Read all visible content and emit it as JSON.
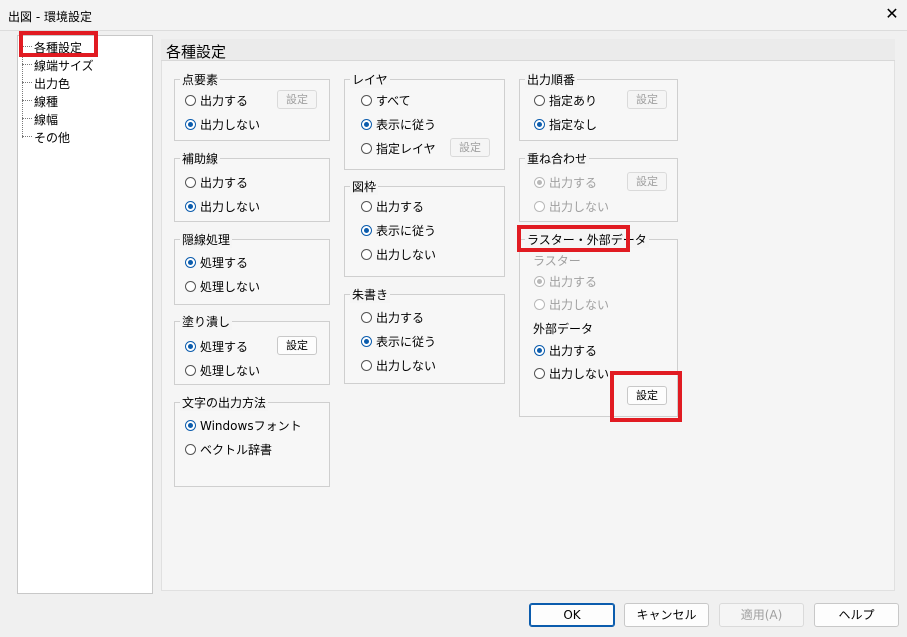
{
  "window": {
    "title": "出図 - 環境設定",
    "close_glyph": "✕"
  },
  "tree": {
    "items": [
      "各種設定",
      "線端サイズ",
      "出力色",
      "線種",
      "線幅",
      "その他"
    ]
  },
  "panel": {
    "title": "各種設定"
  },
  "groups": {
    "point": {
      "label": "点要素",
      "opt1": "出力する",
      "opt2": "出力しない",
      "button": "設定"
    },
    "aux": {
      "label": "補助線",
      "opt1": "出力する",
      "opt2": "出力しない"
    },
    "hidden": {
      "label": "隠線処理",
      "opt1": "処理する",
      "opt2": "処理しない"
    },
    "fill": {
      "label": "塗り潰し",
      "opt1": "処理する",
      "opt2": "処理しない",
      "button": "設定"
    },
    "text": {
      "label": "文字の出力方法",
      "opt1": "Windowsフォント",
      "opt2": "ベクトル辞書"
    },
    "layer": {
      "label": "レイヤ",
      "opt1": "すべて",
      "opt2": "表示に従う",
      "opt3": "指定レイヤ",
      "button": "設定"
    },
    "frame": {
      "label": "図枠",
      "opt1": "出力する",
      "opt2": "表示に従う",
      "opt3": "出力しない"
    },
    "redline": {
      "label": "朱書き",
      "opt1": "出力する",
      "opt2": "表示に従う",
      "opt3": "出力しない"
    },
    "order": {
      "label": "出力順番",
      "opt1": "指定あり",
      "opt2": "指定なし",
      "button": "設定"
    },
    "overlay": {
      "label": "重ね合わせ",
      "opt1": "出力する",
      "opt2": "出力しない",
      "button": "設定"
    },
    "raster": {
      "label": "ラスター・外部データ",
      "sub1": "ラスター",
      "r_opt1": "出力する",
      "r_opt2": "出力しない",
      "sub2": "外部データ",
      "e_opt1": "出力する",
      "e_opt2": "出力しない",
      "button": "設定"
    }
  },
  "footer": {
    "ok": "OK",
    "cancel": "キャンセル",
    "apply": "適用(A)",
    "help": "ヘルプ"
  },
  "colors": {
    "accent": "#0b5cad",
    "highlight": "#e11b22"
  }
}
